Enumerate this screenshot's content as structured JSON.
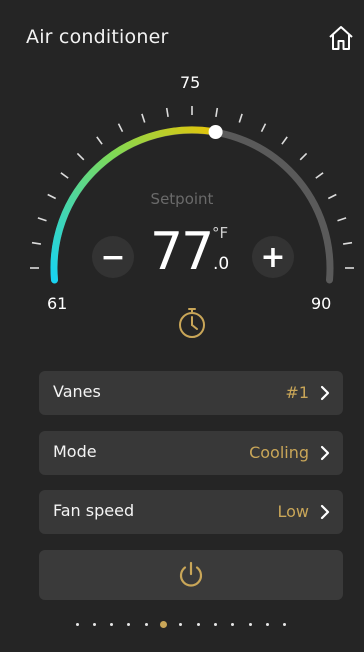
{
  "header": {
    "title": "Air conditioner"
  },
  "dial": {
    "min_label": "61",
    "max_label": "90",
    "top_label": "75",
    "min": 61,
    "max": 90,
    "setpoint_label": "Setpoint",
    "temp_whole": "77",
    "temp_unit": "°F",
    "temp_decimal": ".0",
    "minus_label": "−",
    "plus_label": "+"
  },
  "settings": [
    {
      "label": "Vanes",
      "value": "#1"
    },
    {
      "label": "Mode",
      "value": "Cooling"
    },
    {
      "label": "Fan speed",
      "value": "Low"
    }
  ],
  "pager": {
    "count": 13,
    "active_index": 5
  },
  "colors": {
    "accent": "#c9a658",
    "arc_start": "#19d3f0",
    "arc_mid": "#7ed957",
    "arc_end": "#f2c200",
    "arc_track": "#5a5a5a"
  },
  "icons": {
    "home": "home-icon",
    "timer": "timer-icon",
    "power": "power-icon",
    "chevron": "chevron-right-icon"
  }
}
